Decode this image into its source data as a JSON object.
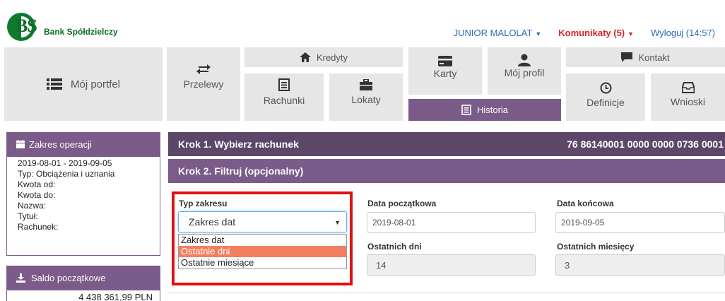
{
  "header": {
    "logo_bs": "BS",
    "logo_bank": "Bank Spółdzielczy",
    "user_label": "JUNIOR MALOLAT",
    "messages_label": "Komunikaty (5)",
    "logout_label": "Wyloguj (14:57)"
  },
  "nav": {
    "portfolio": "Mój portfel",
    "transfers": "Przelewy",
    "credits": "Kredyty",
    "accounts": "Rachunki",
    "deposits": "Lokaty",
    "cards": "Karty",
    "profile": "Mój profil",
    "history": "Historia",
    "contact": "Kontakt",
    "definitions": "Definicje",
    "applications": "Wnioski"
  },
  "sidebar": {
    "range_title": "Zakres operacji",
    "range_lines": [
      "2019-08-01 - 2019-09-05",
      "Typ: Obciążenia i uznania",
      "Kwota od:",
      "Kwota do:",
      "Nazwa:",
      "Tytuł:",
      "Rachunek:"
    ],
    "balance_title": "Saldo początkowe",
    "balance_value": "4 438 361,99 PLN"
  },
  "main": {
    "step1_label": "Krok 1. Wybierz rachunek",
    "account_number": "76 86140001 0000 0000 0736 0001",
    "step2_label": "Krok 2. Filtruj (opcjonalny)",
    "range_type_label": "Typ zakresu",
    "range_type_selected": "Zakres dat",
    "range_type_options": [
      "Zakres dat",
      "Ostatnie dni",
      "Ostatnie miesiące"
    ],
    "range_type_highlighted_index": 1,
    "start_date_label": "Data początkowa",
    "start_date_value": "2019-08-01",
    "end_date_label": "Data końcowa",
    "end_date_value": "2019-09-05",
    "last_days_label": "Ostatnich dni",
    "last_days_value": "14",
    "last_months_label": "Ostatnich miesięcy",
    "last_months_value": "3"
  },
  "colors": {
    "purple": "#7b5b89",
    "dark_purple": "#5d4768",
    "highlight": "#f47f5e",
    "alert_red": "#d8232a",
    "link_blue": "#2a6ab0"
  }
}
